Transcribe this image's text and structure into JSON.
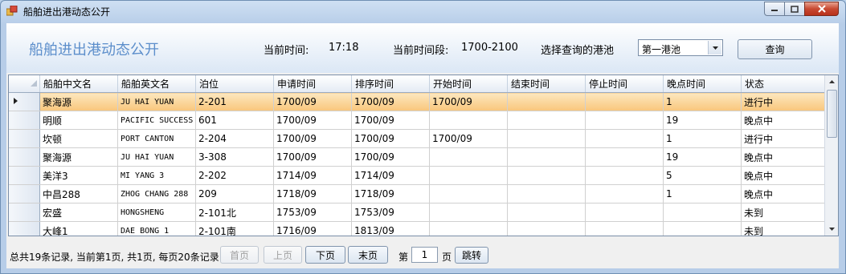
{
  "window": {
    "title": "船舶进出港动态公开"
  },
  "header": {
    "title": "船舶进出港动态公开",
    "current_time_label": "当前时间:",
    "current_time_value": "17:18",
    "time_period_label": "当前时间段:",
    "time_period_value": "1700-2100",
    "port_select_label": "选择查询的港池",
    "port_selected": "第一港池",
    "query_button": "查询"
  },
  "grid": {
    "columns": [
      "船舶中文名",
      "船舶英文名",
      "泊位",
      "申请时间",
      "排序时间",
      "开始时间",
      "结束时间",
      "停止时间",
      "晚点时间",
      "状态"
    ],
    "rows": [
      [
        "聚海源",
        "JU HAI YUAN",
        "2-201",
        "1700/09",
        "1700/09",
        "1700/09",
        "",
        "",
        "1",
        "进行中"
      ],
      [
        "明顺",
        "PACIFIC SUCCESS",
        "601",
        "1700/09",
        "1700/09",
        "",
        "",
        "",
        "19",
        "晚点中"
      ],
      [
        "坎顿",
        "PORT CANTON",
        "2-204",
        "1700/09",
        "1700/09",
        "1700/09",
        "",
        "",
        "1",
        "进行中"
      ],
      [
        "聚海源",
        "JU HAI YUAN",
        "3-308",
        "1700/09",
        "1700/09",
        "",
        "",
        "",
        "19",
        "晚点中"
      ],
      [
        "美洋3",
        "MI YANG 3",
        "2-202",
        "1714/09",
        "1714/09",
        "",
        "",
        "",
        "5",
        "晚点中"
      ],
      [
        "中昌288",
        "ZHOG CHANG 288",
        "209",
        "1718/09",
        "1718/09",
        "",
        "",
        "",
        "1",
        "晚点中"
      ],
      [
        "宏盛",
        "HONGSHENG",
        "2-101北",
        "1753/09",
        "1753/09",
        "",
        "",
        "",
        "",
        "未到"
      ],
      [
        "大峰1",
        "DAE BONG 1",
        "2-101南",
        "1716/09",
        "1813/09",
        "",
        "",
        "",
        "",
        "未到"
      ]
    ],
    "selected_row": 0
  },
  "footer": {
    "summary": "总共19条记录, 当前第1页, 共1页, 每页20条记录",
    "first_page": "首页",
    "prev_page": "上页",
    "next_page": "下页",
    "last_page": "末页",
    "page_prefix": "第",
    "page_value": "1",
    "page_suffix": "页",
    "jump": "跳转"
  },
  "colors": {
    "accent_title": "#5c8ecb",
    "selected_row": "#f9c67c"
  }
}
